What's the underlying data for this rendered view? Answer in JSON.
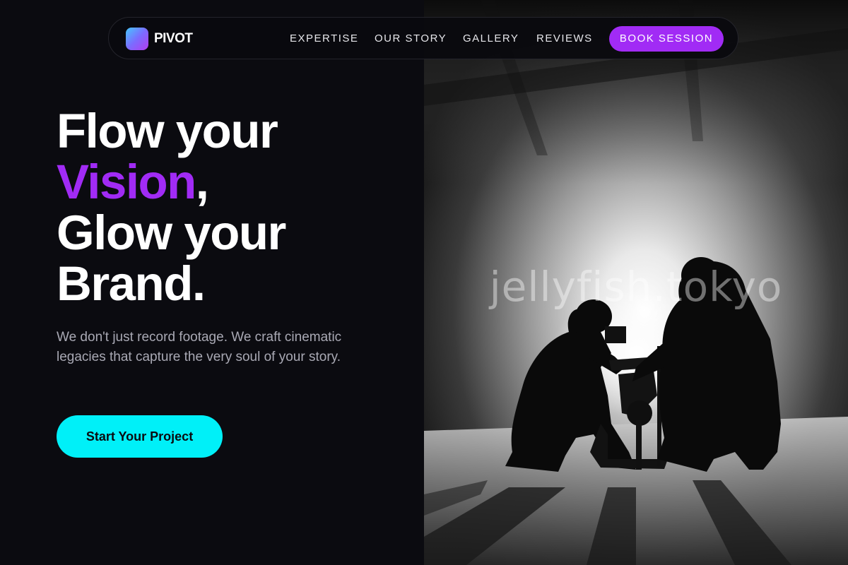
{
  "brand": {
    "name": "PIVOT",
    "logo_icon": "gradient-square-logo",
    "gradient_colors": [
      "#45c8ff",
      "#7b6cff",
      "#b43cf0"
    ]
  },
  "nav": {
    "links": [
      "EXPERTISE",
      "OUR STORY",
      "GALLERY",
      "REVIEWS"
    ],
    "cta": "BOOK SESSION"
  },
  "hero": {
    "line1": "Flow your",
    "accent_word": "Vision",
    "accent_punct": ",",
    "line3": "Glow your",
    "line4": "Brand.",
    "lead": "We don't just record footage. We craft cinematic legacies that capture the very soul of your story.",
    "cta": "Start Your Project"
  },
  "photo": {
    "watermark": "jellyfish.tokyo"
  },
  "colors": {
    "background": "#0b0b10",
    "accent_purple": "#a12bf5",
    "accent_cyan": "#00f0f8",
    "text_primary": "#ffffff",
    "text_muted": "#a9a9b4"
  }
}
